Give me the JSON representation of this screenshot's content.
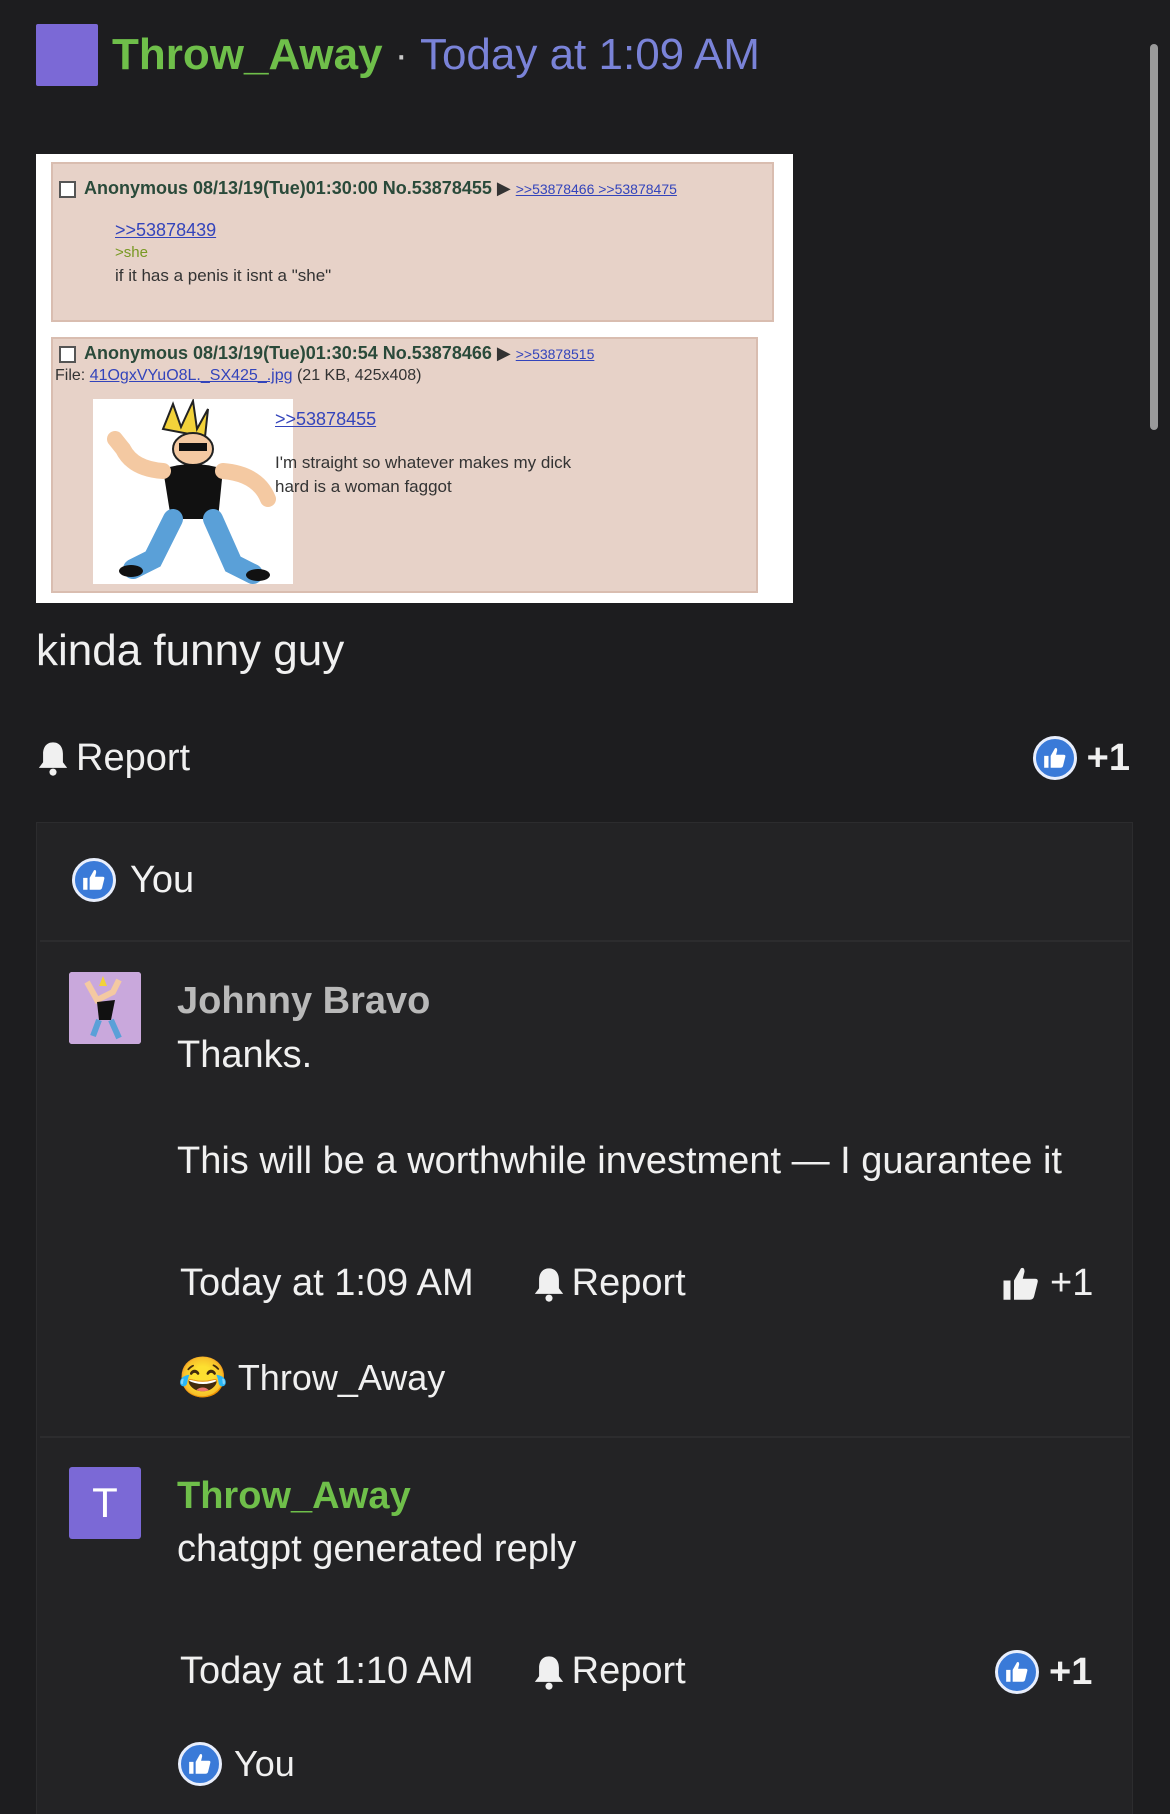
{
  "post": {
    "author": "Throw_Away",
    "separator": "·",
    "timestamp": "Today at 1:09 AM",
    "caption": "kinda funny guy",
    "report_label": "Report",
    "like_count": "+1",
    "likers": [
      "You"
    ],
    "colors": {
      "author": "#6fbf4a",
      "timestamp": "#7a83d8",
      "avatar": "#7b69d6"
    }
  },
  "image": {
    "post1": {
      "header": "Anonymous 08/13/19(Tue)01:30:00 No.53878455",
      "replies": ">>53878466 >>53878475",
      "quote_link": ">>53878439",
      "greentext": ">she",
      "body": "if it has a penis it isnt a \"she\""
    },
    "post2": {
      "header": "Anonymous 08/13/19(Tue)01:30:54 No.53878466",
      "replies": ">>53878515",
      "file_label": "File:",
      "file_name": "41OgxVYuO8L._SX425_.jpg",
      "file_info": "(21 KB, 425x408)",
      "quote_link": ">>53878455",
      "body_line1": "I'm straight so whatever makes my dick",
      "body_line2": "hard is a woman faggot"
    }
  },
  "comments": [
    {
      "author": "Johnny Bravo",
      "author_color": "#b9b9b9",
      "line1": "Thanks.",
      "line2": "This will be a worthwhile investment — I guarantee it",
      "timestamp": "Today at 1:09 AM",
      "report_label": "Report",
      "like_count": "+1",
      "reaction_emoji": "😂",
      "reaction_user": "Throw_Away"
    },
    {
      "author": "Throw_Away",
      "author_color": "#6fbf4a",
      "avatar_letter": "T",
      "line1": "chatgpt generated reply",
      "timestamp": "Today at 1:10 AM",
      "report_label": "Report",
      "like_count": "+1",
      "reaction_user": "You"
    }
  ]
}
